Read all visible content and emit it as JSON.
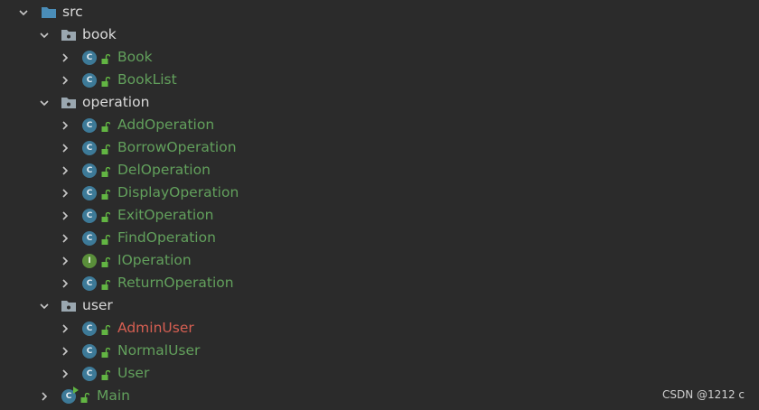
{
  "tree": {
    "src": {
      "label": "src",
      "icon": "folder-icon",
      "expanded": true
    },
    "book": {
      "label": "book",
      "icon": "package-icon",
      "expanded": true,
      "items": [
        {
          "label": "Book",
          "kind": "class"
        },
        {
          "label": "BookList",
          "kind": "class"
        }
      ]
    },
    "operation": {
      "label": "operation",
      "icon": "package-icon",
      "expanded": true,
      "items": [
        {
          "label": "AddOperation",
          "kind": "class"
        },
        {
          "label": "BorrowOperation",
          "kind": "class"
        },
        {
          "label": "DelOperation",
          "kind": "class"
        },
        {
          "label": "DisplayOperation",
          "kind": "class"
        },
        {
          "label": "ExitOperation",
          "kind": "class"
        },
        {
          "label": "FindOperation",
          "kind": "class"
        },
        {
          "label": "IOperation",
          "kind": "interface"
        },
        {
          "label": "ReturnOperation",
          "kind": "class"
        }
      ]
    },
    "user": {
      "label": "user",
      "icon": "package-icon",
      "expanded": true,
      "items": [
        {
          "label": "AdminUser",
          "kind": "class",
          "status": "error"
        },
        {
          "label": "NormalUser",
          "kind": "class"
        },
        {
          "label": "User",
          "kind": "class"
        }
      ]
    },
    "main": {
      "label": "Main",
      "kind": "main-class"
    }
  },
  "icon_letters": {
    "class": "C",
    "interface": "I"
  },
  "colors": {
    "background": "#2b2b2b",
    "folder_text": "#dadada",
    "class_text": "#62a05c",
    "error_text": "#d65f52",
    "class_icon": "#3d7a98",
    "interface_icon": "#5a8f3a"
  },
  "watermark": "CSDN @1212 c"
}
